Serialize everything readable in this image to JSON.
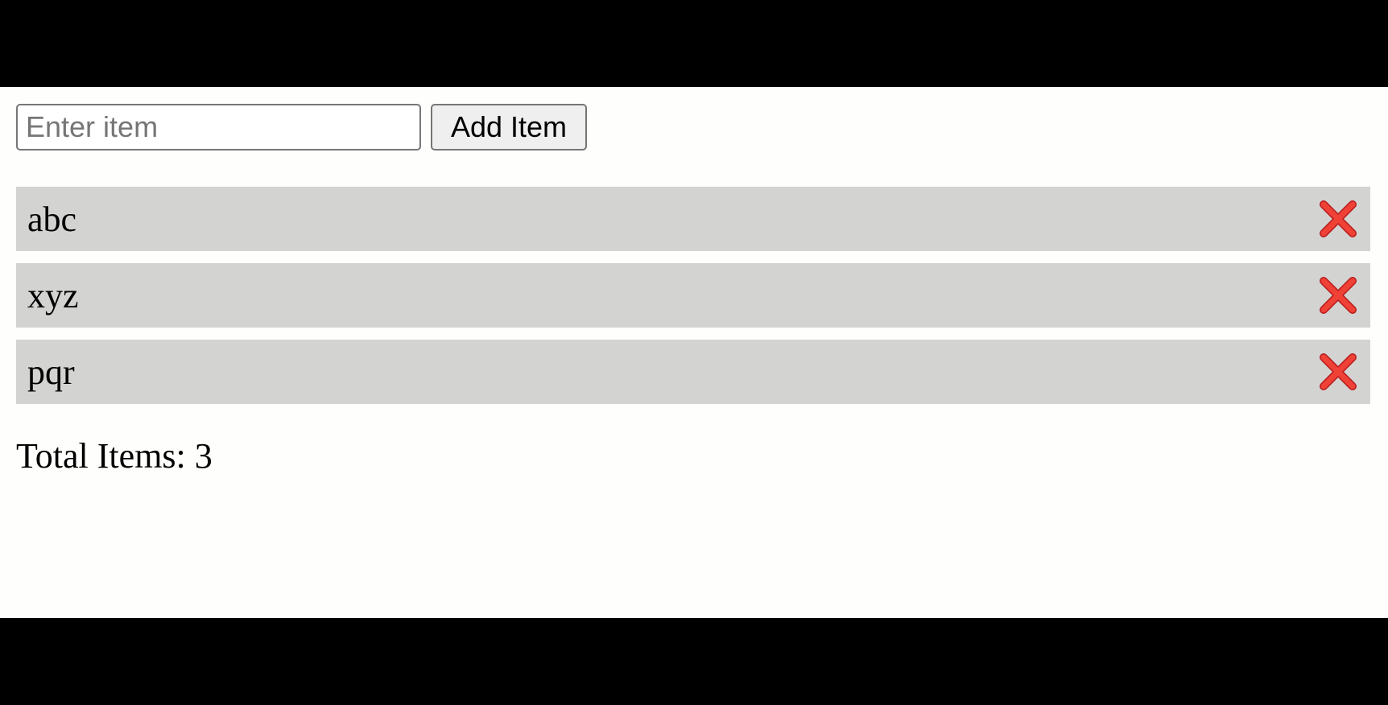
{
  "form": {
    "input_placeholder": "Enter item",
    "input_value": "",
    "add_button_label": "Add Item"
  },
  "items": [
    {
      "label": "abc",
      "delete_icon": "close-icon"
    },
    {
      "label": "xyz",
      "delete_icon": "close-icon"
    },
    {
      "label": "pqr",
      "delete_icon": "close-icon"
    }
  ],
  "footer": {
    "total_label": "Total Items: 3"
  },
  "colors": {
    "item_background": "#d3d3d2",
    "delete_icon": "#e53935",
    "page_background": "#fefefd"
  }
}
